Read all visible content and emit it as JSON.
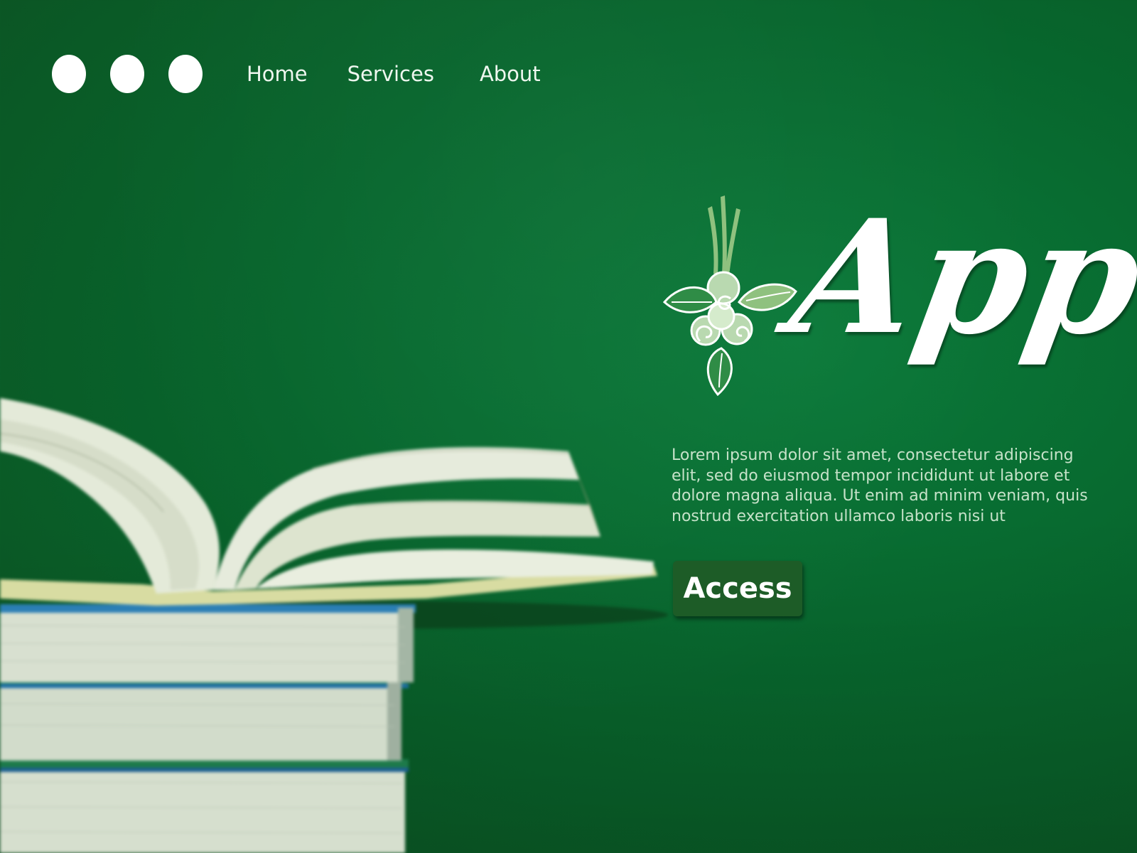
{
  "nav": {
    "dots": [
      "dot",
      "dot",
      "dot"
    ],
    "items": [
      {
        "label": "Home"
      },
      {
        "label": "Services"
      },
      {
        "label": "About"
      }
    ]
  },
  "brand": {
    "wordmark": "App",
    "logo_icon": "leaf-flower-icon",
    "logo_colors": [
      "#b9d9b0",
      "#8fc17f",
      "#ffffff"
    ]
  },
  "hero": {
    "description": "Lorem ipsum dolor sit amet, consectetur adipiscing elit, sed do eiusmod tempor incididunt ut labore et dolore magna aliqua. Ut enim ad minim veniam, quis nostrud exercitation ullamco laboris nisi ut",
    "cta_label": "Access"
  },
  "illustration": {
    "name": "stack-of-books-image"
  },
  "colors": {
    "background": "#07662d",
    "button": "#1d5c27",
    "text_muted": "#c6e2c9"
  }
}
